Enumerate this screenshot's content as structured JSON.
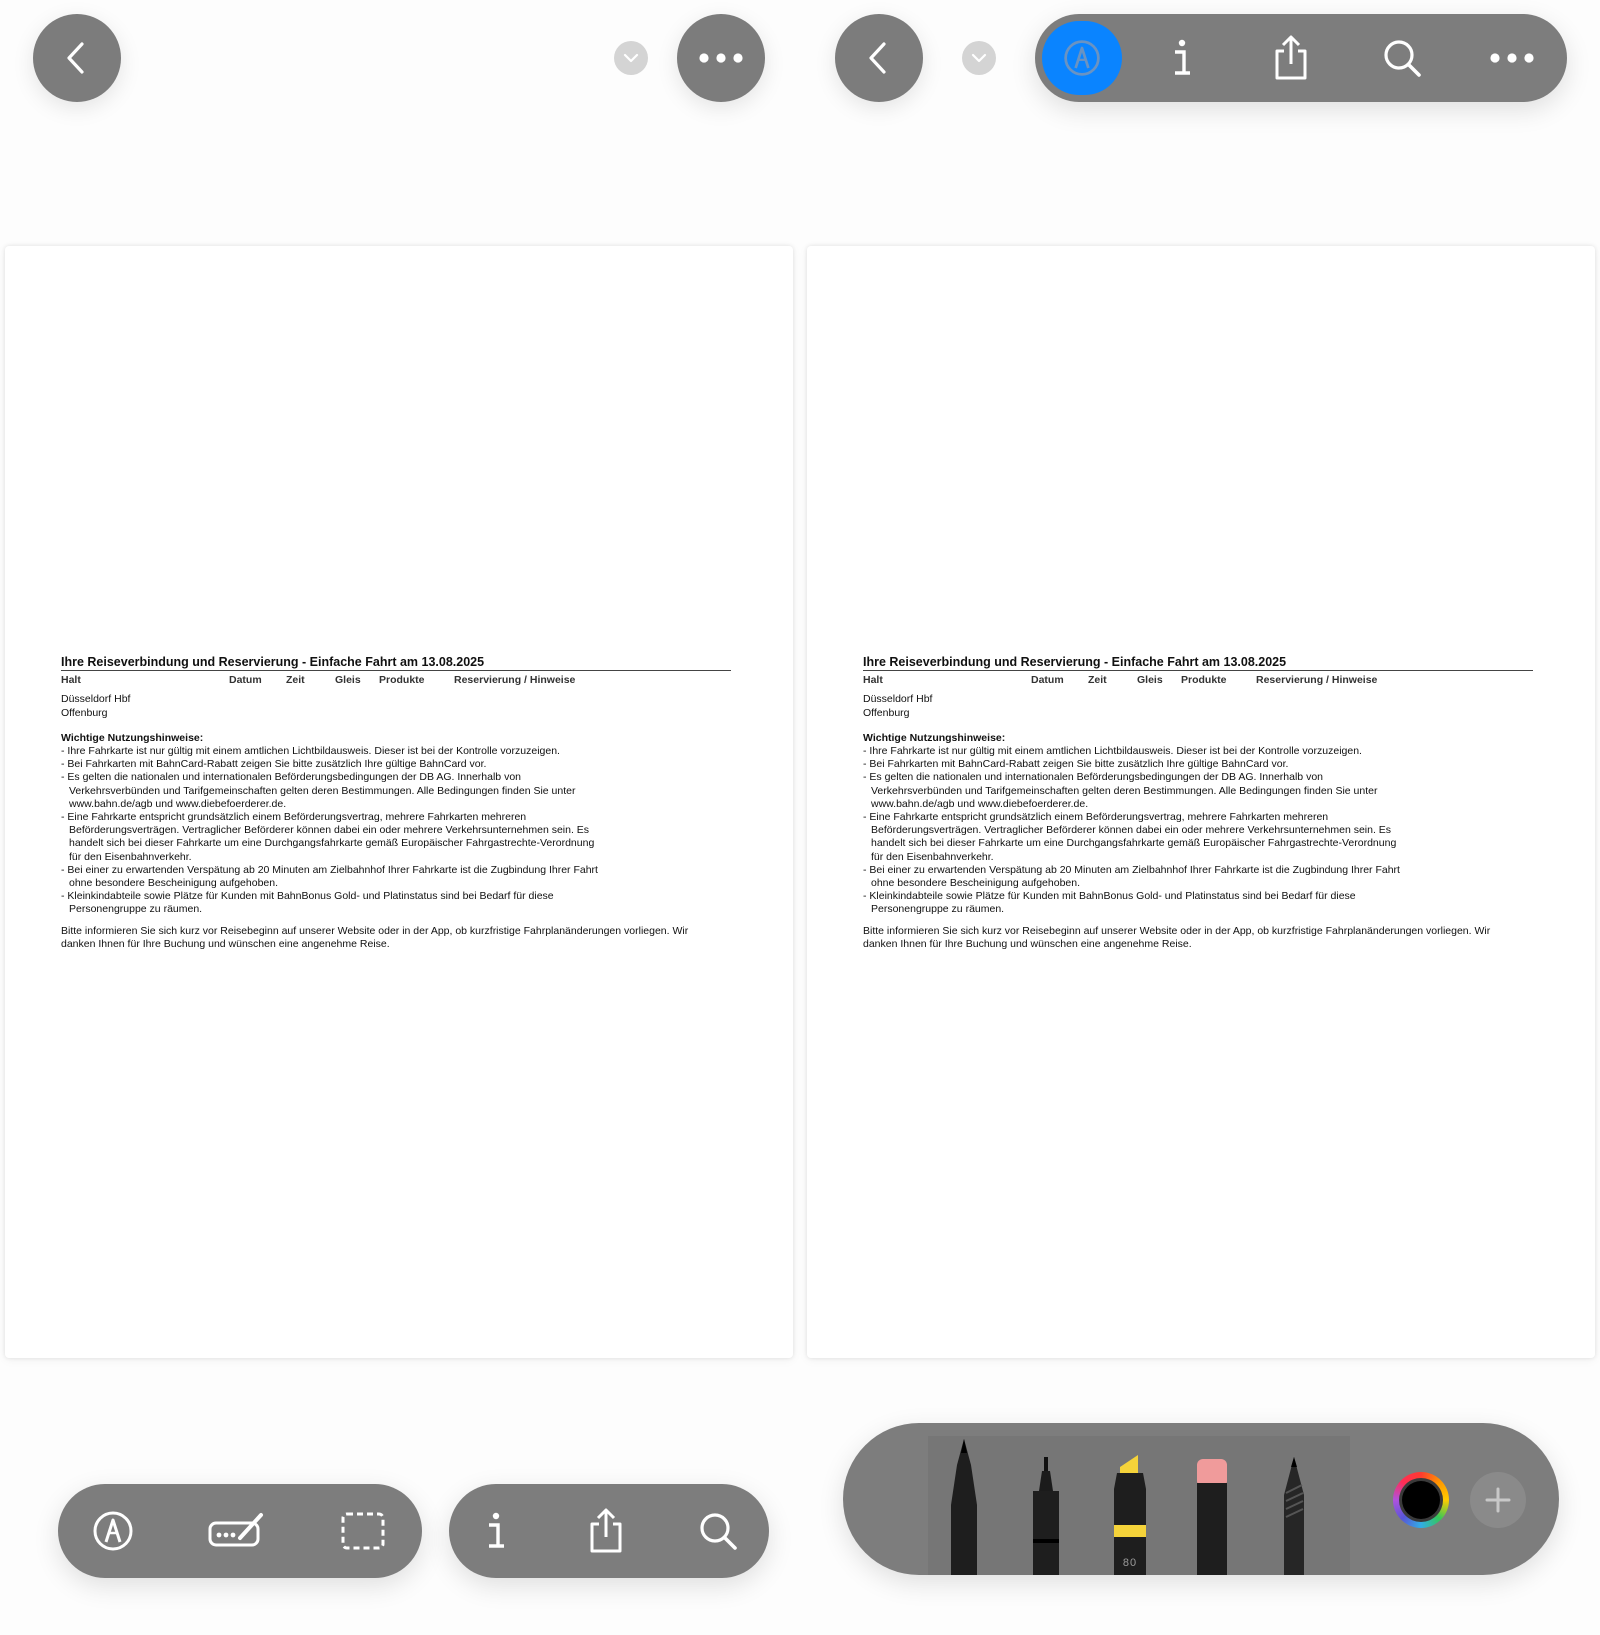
{
  "left_pane": {
    "back_icon": "chevron-left-icon",
    "dropdown_icon": "chevron-down-icon",
    "more_icon": "ellipsis-icon",
    "bottom_tools": [
      "markup-icon",
      "form-fill-icon",
      "selection-icon"
    ],
    "bottom_actions": [
      "info-icon",
      "share-icon",
      "search-icon"
    ]
  },
  "right_pane": {
    "back_icon": "chevron-left-icon",
    "dropdown_icon": "chevron-down-icon",
    "toolbar": [
      "markup-icon",
      "info-icon",
      "share-icon",
      "search-icon",
      "ellipsis-icon"
    ],
    "markup_active_color": "#0a84ff",
    "drawing_tools": [
      {
        "name": "pen",
        "icon": "pen-icon"
      },
      {
        "name": "fineliner",
        "icon": "fineliner-icon"
      },
      {
        "name": "highlighter",
        "icon": "highlighter-icon",
        "label": "80",
        "color": "#f5d33a"
      },
      {
        "name": "eraser",
        "icon": "eraser-icon",
        "color": "#f09b9b"
      },
      {
        "name": "pencil",
        "icon": "pencil-icon"
      }
    ],
    "selected_color": "#000000",
    "add_icon": "plus-icon"
  },
  "document": {
    "title": "Ihre Reiseverbindung und Reservierung - Einfache Fahrt am 13.08.2025",
    "columns": [
      "Halt",
      "Datum",
      "Zeit",
      "Gleis",
      "Produkte",
      "Reservierung / Hinweise"
    ],
    "stops": [
      "Düsseldorf Hbf",
      "Offenburg"
    ],
    "notes_title": "Wichtige Nutzungshinweise:",
    "notes": [
      "- Ihre Fahrkarte ist nur gültig mit einem amtlichen Lichtbildausweis. Dieser ist bei der Kontrolle vorzuzeigen.",
      "- Bei Fahrkarten mit BahnCard-Rabatt zeigen Sie bitte zusätzlich Ihre gültige BahnCard vor.",
      "- Es gelten die nationalen und internationalen Beförderungsbedingungen der DB AG. Innerhalb von\nVerkehrsverbünden und Tarifgemeinschaften gelten deren Bestimmungen. Alle Bedingungen finden Sie unter\nwww.bahn.de/agb und www.diebefoerderer.de.",
      "- Eine Fahrkarte entspricht grundsätzlich einem Beförderungsvertrag, mehrere Fahrkarten mehreren\nBeförderungsverträgen. Vertraglicher Beförderer können dabei ein oder mehrere Verkehrsunternehmen sein. Es\nhandelt sich bei dieser Fahrkarte um eine Durchgangsfahrkarte gemäß Europäischer Fahrgastrechte-Verordnung\nfür den Eisenbahnverkehr.",
      "- Bei einer zu erwartenden Verspätung ab 20 Minuten am Zielbahnhof Ihrer Fahrkarte ist die Zugbindung Ihrer Fahrt\nohne besondere Bescheinigung aufgehoben.",
      "- Kleinkindabteile sowie Plätze für Kunden mit BahnBonus Gold- und Platinstatus sind bei Bedarf für diese\nPersonengruppe zu räumen."
    ],
    "closing": "Bitte informieren Sie sich kurz vor Reisebeginn auf unserer Website oder in der App, ob kurzfristige Fahrplanänderungen vorliegen. Wir\ndanken Ihnen für Ihre Buchung und wünschen eine angenehme Reise."
  }
}
